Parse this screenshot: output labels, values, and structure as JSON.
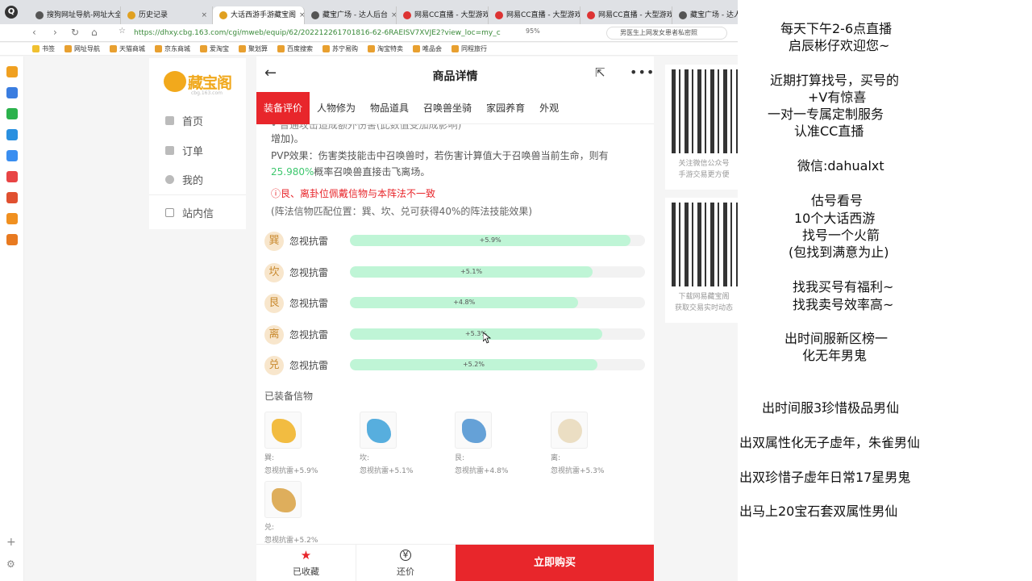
{
  "browser": {
    "app_icon": "Q",
    "tabs": [
      {
        "label": "搜狗网址导航-网址大全",
        "active": false
      },
      {
        "label": "历史记录",
        "active": false
      },
      {
        "label": "大话西游手游藏宝阁",
        "active": true
      },
      {
        "label": "藏宝广场 - 达人后台",
        "active": false
      },
      {
        "label": "网易CC直播 - 大型游戏",
        "active": false
      },
      {
        "label": "网易CC直播 - 大型游戏",
        "active": false
      },
      {
        "label": "网易CC直播 - 大型游戏",
        "active": false
      },
      {
        "label": "藏宝广场 - 达人后台",
        "active": false
      }
    ],
    "url": "https://dhxy.cbg.163.com/cgi/mweb/equip/62/202212261701816-62-6RAEISV7XVJE2?view_loc=my_c",
    "zoom": "95%",
    "search_text": "男医生上网发女患者私密照",
    "bookmarks": [
      "书签",
      "网址导航",
      "天猫商城",
      "京东商城",
      "爱淘宝",
      "聚划算",
      "百度搜索",
      "苏宁易购",
      "淘宝特卖",
      "唯品会",
      "同程旅行"
    ]
  },
  "leftnav": {
    "logo_text": "藏宝阁",
    "logo_sub": "cbg.163.com",
    "items": [
      {
        "label": "首页",
        "icon": "home-icon"
      },
      {
        "label": "订单",
        "icon": "order-icon"
      },
      {
        "label": "我的",
        "icon": "user-icon"
      },
      {
        "label": "站内信",
        "icon": "mail-icon"
      }
    ]
  },
  "main": {
    "title": "商品详情",
    "back_icon": "←",
    "share_icon": "⇱",
    "more_icon": "•••",
    "tabs": [
      "装备评价",
      "人物修为",
      "物品道具",
      "召唤兽坐骑",
      "家园养育",
      "外观"
    ],
    "cut_text": "• 普通攻击造成额外伤害(此数值受加成影响)",
    "line1": "增加)。",
    "pvp_prefix": "PVP效果：伤害类技能击中召唤兽时，若伤害计算值大于召唤兽当前生命，则有",
    "pvp_value": "25.980%",
    "pvp_suffix": "概率召唤兽直接击飞离场。",
    "warning": "ⓘ艮、离卦位佩戴信物与本阵法不一致",
    "note": "(阵法信物匹配位置：巽、坎、兑可获得40%的阵法技能效果)",
    "bars": [
      {
        "badge": "巽",
        "label": "忽视抗雷",
        "value": "+5.9%",
        "percent": 5.9
      },
      {
        "badge": "坎",
        "label": "忽视抗雷",
        "value": "+5.1%",
        "percent": 5.1
      },
      {
        "badge": "艮",
        "label": "忽视抗雷",
        "value": "+4.8%",
        "percent": 4.8
      },
      {
        "badge": "离",
        "label": "忽视抗雷",
        "value": "+5.3%",
        "percent": 5.3
      },
      {
        "badge": "兑",
        "label": "忽视抗雷",
        "value": "+5.2%",
        "percent": 5.2
      }
    ],
    "section_title": "已装备信物",
    "items": [
      {
        "slot": "巽:",
        "desc": "忽视抗雷+5.9%"
      },
      {
        "slot": "坎:",
        "desc": "忽视抗雷+5.1%"
      },
      {
        "slot": "艮:",
        "desc": "忽视抗雷+4.8%"
      },
      {
        "slot": "离:",
        "desc": "忽视抗雷+5.3%"
      },
      {
        "slot": "兑:",
        "desc": "忽视抗雷+5.2%"
      }
    ],
    "bottom": {
      "fav_label": "已收藏",
      "fav_icon": "★",
      "bargain_label": "还价",
      "bargain_icon": "¥",
      "buy_label": "立即购买"
    }
  },
  "qr": {
    "caption1": "关注微信公众号\n手游交易更方便",
    "caption2": "下载网易藏宝阁\n获取交易实时动态"
  },
  "overlay": {
    "lines": [
      "每天下午2-6点直播",
      "启辰彬仔欢迎您~",
      "近期打算找号，买号的",
      "+V有惊喜",
      "一对一专属定制服务",
      "认准CC直播",
      "微信:dahualxt",
      "估号看号",
      "10个大话西游",
      "找号一个火箭",
      "(包找到满意为止)",
      "找我买号有福利~",
      "找我卖号效率高~",
      "出时间服新区榜一",
      "化无年男鬼",
      "出时间服3珍惜极品男仙",
      "出双属性化无子虚年，朱雀男仙",
      "出双珍惜子虚年日常17星男鬼",
      "出马上20宝石套双属性男仙"
    ]
  }
}
